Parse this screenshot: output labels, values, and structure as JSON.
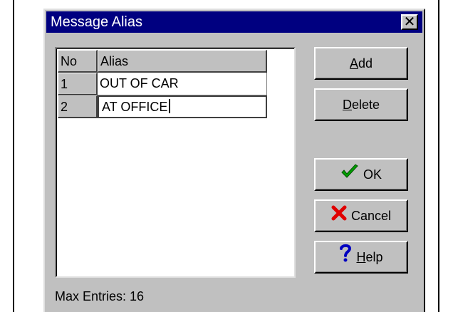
{
  "window": {
    "title": "Message Alias",
    "close_glyph": "✕"
  },
  "grid": {
    "headers": [
      "No",
      "Alias"
    ],
    "rows": [
      {
        "no": "1",
        "alias": "OUT OF CAR"
      },
      {
        "no": "2",
        "alias": "AT OFFICE"
      }
    ]
  },
  "buttons": {
    "add": {
      "mnemonic": "A",
      "rest": "dd"
    },
    "delete": {
      "mnemonic": "D",
      "rest": "elete"
    },
    "ok": {
      "label": "OK",
      "icon": "checkmark-icon",
      "color": "#00a000"
    },
    "cancel": {
      "label": "Cancel",
      "icon": "x-icon",
      "color": "#e00000"
    },
    "help": {
      "mnemonic": "H",
      "rest": "elp",
      "icon": "question-icon",
      "color": "#0000c0"
    }
  },
  "status": {
    "max_entries": "Max Entries: 16"
  }
}
